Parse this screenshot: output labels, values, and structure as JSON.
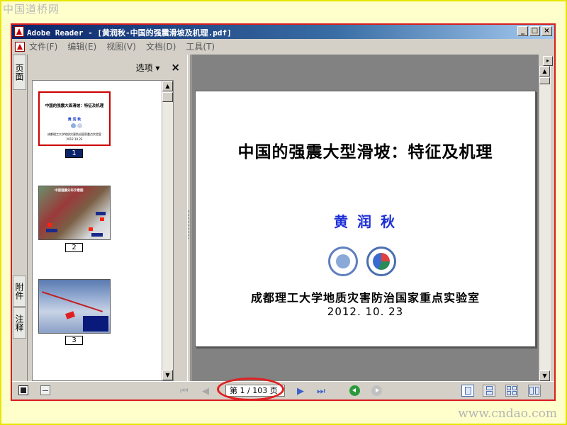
{
  "watermarks": {
    "top": "中国道桥网",
    "bottom": "www.cndao.com"
  },
  "window": {
    "title": "Adobe Reader - [黄润秋-中国的强震滑坡及机理.pdf]",
    "minimize": "_",
    "maximize": "□",
    "close": "×"
  },
  "menu": {
    "file": "文件(F)",
    "edit": "编辑(E)",
    "view": "视图(V)",
    "document": "文档(D)",
    "tools": "工具(T)"
  },
  "side_tabs": {
    "pages": "页面",
    "attachments": "附件",
    "comments": "注释"
  },
  "nav_panel": {
    "options": "选项 ▾",
    "close": "×",
    "thumbnails": [
      {
        "label": "1",
        "title": "中国的强震大面滑坡：特征及机理",
        "author": "黄 润 秋",
        "org": "成都理工大学地质灾害防治国家重点实验室",
        "date": "2012.10.23"
      },
      {
        "label": "2",
        "title": "中国强震分布示意图"
      },
      {
        "label": "3"
      }
    ]
  },
  "slide": {
    "title": "中国的强震大型滑坡：特征及机理",
    "author": "黄 润 秋",
    "organization": "成都理工大学地质灾害防治国家重点实验室",
    "date": "2012. 10. 23"
  },
  "statusbar": {
    "page_indicator": "第 1 / 103 页"
  },
  "colors": {
    "highlight": "#e02020",
    "titlebar_start": "#0a246a",
    "author_blue": "#1c2fd6",
    "selection": "#0a246a"
  }
}
